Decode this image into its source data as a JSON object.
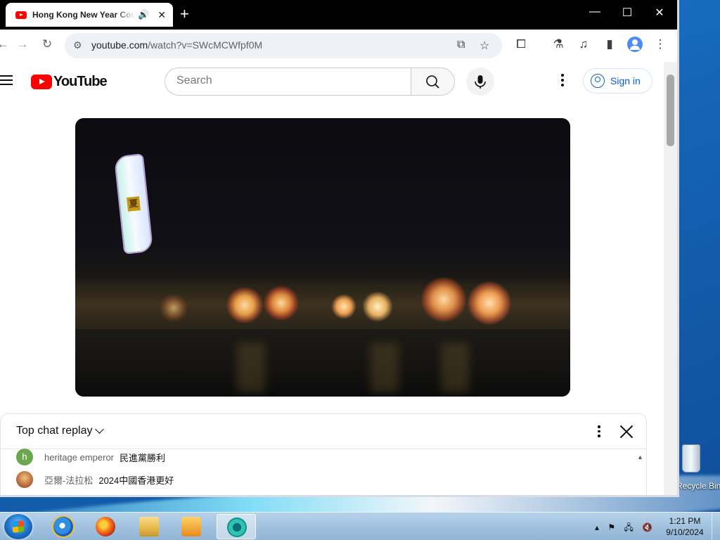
{
  "browser": {
    "tab_title": "Hong Kong New Year Countdown",
    "url_host": "youtube.com",
    "url_path": "/watch?v=SWcMCWfpf0M",
    "new_tab_glyph": "+",
    "tab_close_glyph": "✕",
    "speaker_glyph": "🔊",
    "window_min": "—",
    "window_max": "☐",
    "window_close": "✕"
  },
  "youtube": {
    "logo_text": "YouTube",
    "search_placeholder": "Search",
    "sign_in": "Sign in"
  },
  "chat": {
    "title": "Top chat replay",
    "messages": [
      {
        "initial": "h",
        "avatar_color": "#6aa84f",
        "author": "heritage emperor",
        "text": "民進黨勝利"
      },
      {
        "initial": "",
        "avatar_color": "#b86b3c",
        "author": "亞爾-法拉松",
        "text": "2024中國香港更好"
      }
    ]
  },
  "video": {
    "overlay_char": "夏"
  },
  "desktop": {
    "recycle_label": "Recycle Bin"
  },
  "taskbar": {
    "time": "1:21 PM",
    "date": "9/10/2024"
  },
  "colors": {
    "yt_red": "#ff0000",
    "link_blue": "#065fd4",
    "desktop_blue": "#1565b8"
  }
}
